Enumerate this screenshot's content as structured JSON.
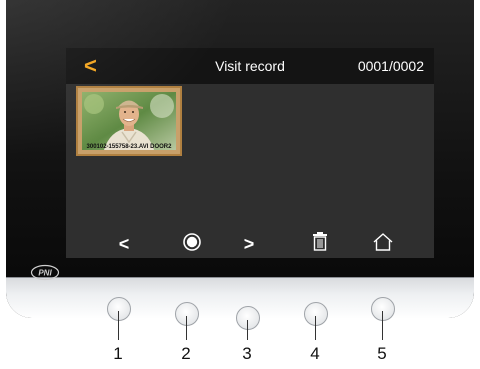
{
  "screen": {
    "back_label": "<",
    "title": "Visit record",
    "page_counter": "0001/0002",
    "thumbnail": {
      "filename": "300102-155758-23.AVI DOOR2"
    },
    "controls": {
      "prev_label": "<",
      "next_label": ">",
      "record_icon": "record-circle-icon",
      "delete_icon": "trash-icon",
      "home_icon": "home-icon"
    }
  },
  "brand": {
    "logo": "PNI"
  },
  "hardware_buttons": [
    "1",
    "2",
    "3",
    "4",
    "5"
  ],
  "colors": {
    "accent": "#f3a51f",
    "screen_bg": "#2f2f2f",
    "topbar_bg": "#141414",
    "device_body": "#111111"
  }
}
